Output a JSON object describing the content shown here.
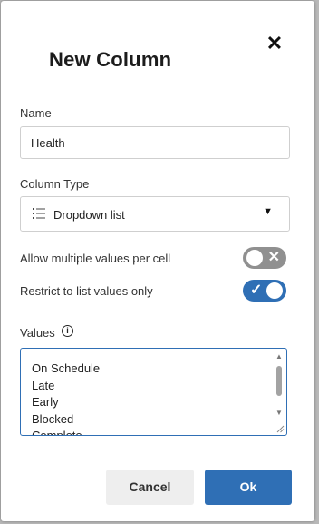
{
  "dialog": {
    "title": "New Column",
    "close_symbol": "✕"
  },
  "name": {
    "label": "Name",
    "value": "Health"
  },
  "column_type": {
    "label": "Column Type",
    "value": "Dropdown list",
    "icon": "list-icon"
  },
  "options": {
    "multiple_values": {
      "label": "Allow multiple values per cell",
      "enabled": false,
      "mark": "✕"
    },
    "restrict_values": {
      "label": "Restrict to list values only",
      "enabled": true,
      "mark": "✓"
    }
  },
  "values": {
    "label": "Values",
    "items": [
      "On Schedule",
      "Late",
      "Early",
      "Blocked",
      "Complete"
    ]
  },
  "buttons": {
    "cancel": "Cancel",
    "ok": "Ok"
  },
  "colors": {
    "accent": "#2f6fb5",
    "toggle_off": "#909090"
  }
}
